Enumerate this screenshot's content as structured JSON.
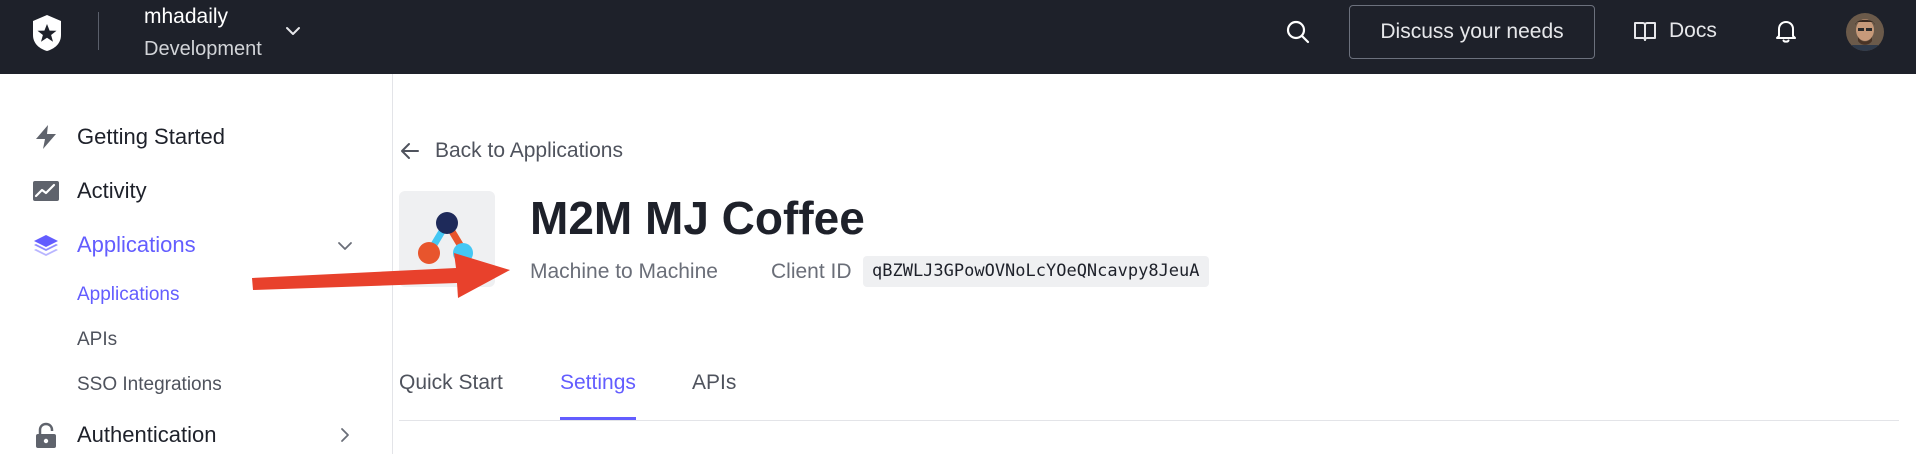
{
  "topbar": {
    "tenant_name": "mhadaily",
    "tenant_env": "Development",
    "discuss_label": "Discuss your needs",
    "docs_label": "Docs"
  },
  "sidebar": {
    "items": [
      {
        "label": "Getting Started",
        "icon": "bolt-icon"
      },
      {
        "label": "Activity",
        "icon": "activity-chart-icon"
      },
      {
        "label": "Applications",
        "icon": "layers-icon",
        "active": true,
        "expanded": true
      },
      {
        "label": "Authentication",
        "icon": "lock-icon"
      }
    ],
    "sub_items": [
      {
        "label": "Applications",
        "active": true
      },
      {
        "label": "APIs"
      },
      {
        "label": "SSO Integrations"
      }
    ]
  },
  "main": {
    "back_label": "Back to Applications",
    "app_title": "M2M MJ Coffee",
    "app_type": "Machine to Machine",
    "client_id_label": "Client ID",
    "client_id": "qBZWLJ3GPowOVNoLcYOeQNcavpy8JeuA",
    "tabs": [
      {
        "label": "Quick Start"
      },
      {
        "label": "Settings",
        "active": true
      },
      {
        "label": "APIs"
      }
    ]
  },
  "colors": {
    "topbar_bg": "#1e212a",
    "accent": "#635dff",
    "annotation_arrow": "#e8412c"
  }
}
